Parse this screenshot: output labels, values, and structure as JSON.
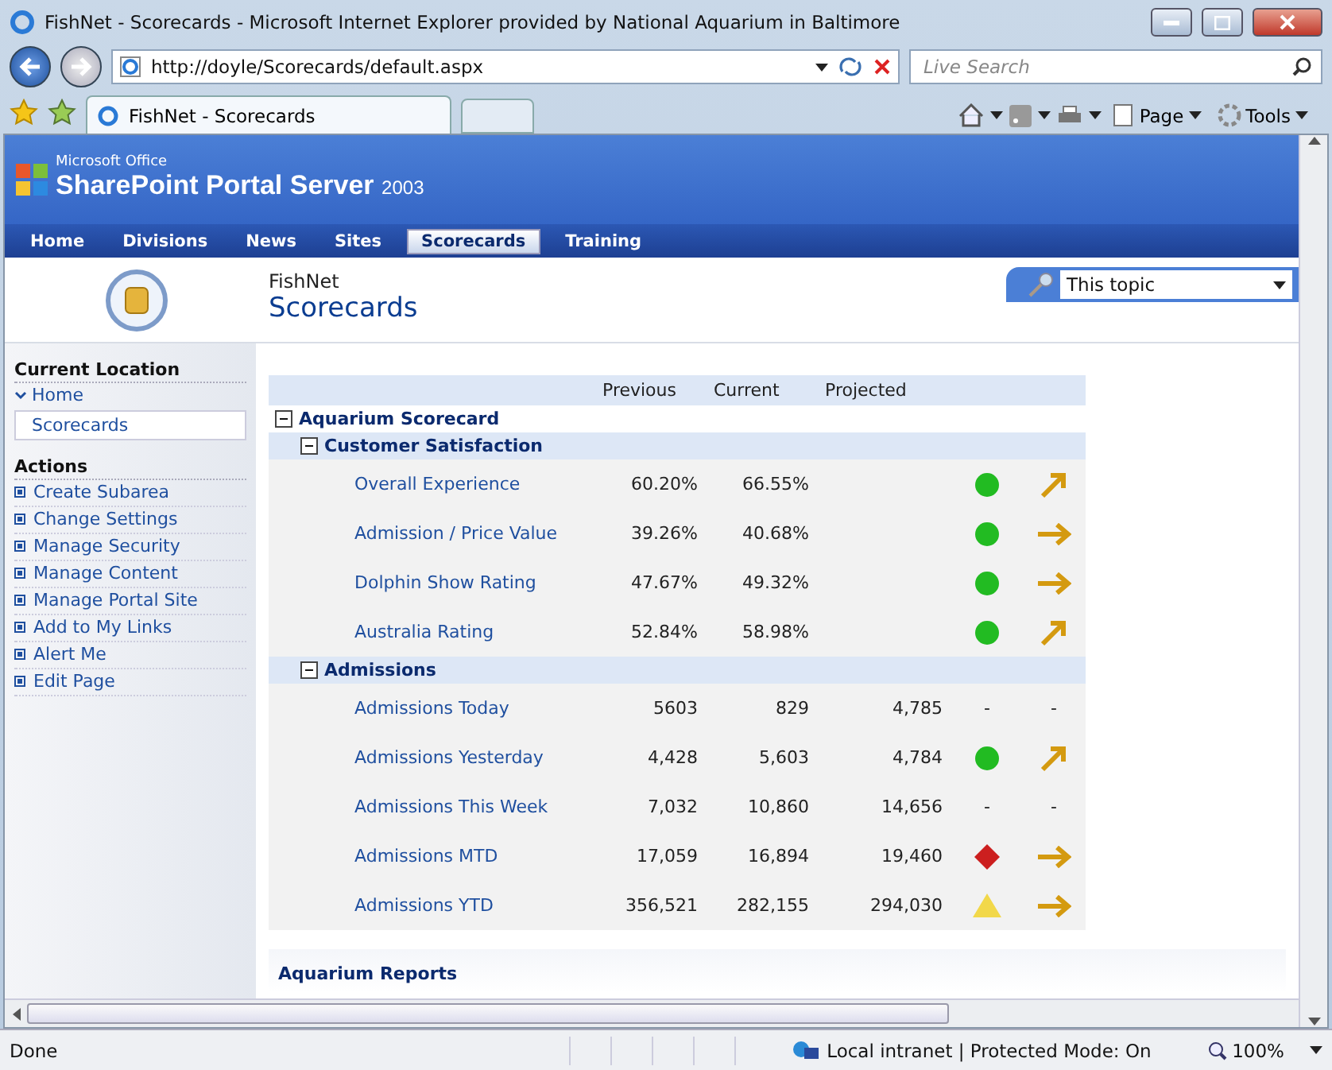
{
  "window": {
    "title": "FishNet - Scorecards - Microsoft Internet Explorer provided by National Aquarium in Baltimore"
  },
  "address_bar": {
    "url": "http://doyle/Scorecards/default.aspx",
    "search_placeholder": "Live Search"
  },
  "browser_tabs": [
    {
      "label": "FishNet - Scorecards",
      "selected": true
    }
  ],
  "command_bar": {
    "page": "Page",
    "tools": "Tools"
  },
  "portal": {
    "brand_small": "Microsoft Office",
    "brand": "SharePoint Portal Server",
    "version": "2003"
  },
  "nav": [
    {
      "label": "Home",
      "selected": false
    },
    {
      "label": "Divisions",
      "selected": false
    },
    {
      "label": "News",
      "selected": false
    },
    {
      "label": "Sites",
      "selected": false
    },
    {
      "label": "Scorecards",
      "selected": true
    },
    {
      "label": "Training",
      "selected": false
    }
  ],
  "search": {
    "scope": "This topic"
  },
  "page_header": {
    "site": "FishNet",
    "title": "Scorecards"
  },
  "sidebar": {
    "location_heading": "Current Location",
    "home": "Home",
    "items": [
      {
        "label": "Scorecards",
        "selected": true
      }
    ],
    "actions_heading": "Actions",
    "actions": [
      "Create Subarea",
      "Change Settings",
      "Manage Security",
      "Manage Content",
      "Manage Portal Site",
      "Add to My Links",
      "Alert Me",
      "Edit Page"
    ]
  },
  "scorecard": {
    "columns": [
      "Previous",
      "Current",
      "Projected"
    ],
    "title": "Aquarium Scorecard",
    "expanded": true,
    "groups": [
      {
        "title": "Customer Satisfaction",
        "expanded": true,
        "rows": [
          {
            "name": "Overall Experience",
            "previous": "60.20%",
            "current": "66.55%",
            "status": {
              "kind": "circle",
              "color": "#22bb22"
            },
            "trend": {
              "kind": "up"
            }
          },
          {
            "name": "Admission / Price Value",
            "previous": "39.26%",
            "current": "40.68%",
            "status": {
              "kind": "circle",
              "color": "#22bb22"
            },
            "trend": {
              "kind": "right"
            }
          },
          {
            "name": "Dolphin Show Rating",
            "previous": "47.67%",
            "current": "49.32%",
            "status": {
              "kind": "circle",
              "color": "#22bb22"
            },
            "trend": {
              "kind": "right"
            }
          },
          {
            "name": "Australia Rating",
            "previous": "52.84%",
            "current": "58.98%",
            "status": {
              "kind": "circle",
              "color": "#22bb22"
            },
            "trend": {
              "kind": "up"
            }
          }
        ]
      },
      {
        "title": "Admissions",
        "expanded": true,
        "rows": [
          {
            "name": "Admissions Today",
            "previous": "5603",
            "current": "829",
            "projected": "4,785",
            "status": {
              "kind": "dash",
              "text": "-"
            },
            "trend": {
              "kind": "dash",
              "text": "-"
            }
          },
          {
            "name": "Admissions Yesterday",
            "previous": "4,428",
            "current": "5,603",
            "projected": "4,784",
            "status": {
              "kind": "circle",
              "color": "#22bb22"
            },
            "trend": {
              "kind": "up"
            }
          },
          {
            "name": "Admissions This Week",
            "previous": "7,032",
            "current": "10,860",
            "projected": "14,656",
            "status": {
              "kind": "dash",
              "text": "-"
            },
            "trend": {
              "kind": "dash",
              "text": "-"
            }
          },
          {
            "name": "Admissions MTD",
            "previous": "17,059",
            "current": "16,894",
            "projected": "19,460",
            "status": {
              "kind": "diamond",
              "color": "#cc1f1f"
            },
            "trend": {
              "kind": "right"
            }
          },
          {
            "name": "Admissions YTD",
            "previous": "356,521",
            "current": "282,155",
            "projected": "294,030",
            "status": {
              "kind": "triangle",
              "color": "#f2d84a"
            },
            "trend": {
              "kind": "right"
            }
          }
        ]
      }
    ]
  },
  "reports_heading": "Aquarium Reports",
  "status_bar": {
    "text": "Done",
    "zone": "Local intranet | Protected Mode: On",
    "zoom": "100%"
  }
}
